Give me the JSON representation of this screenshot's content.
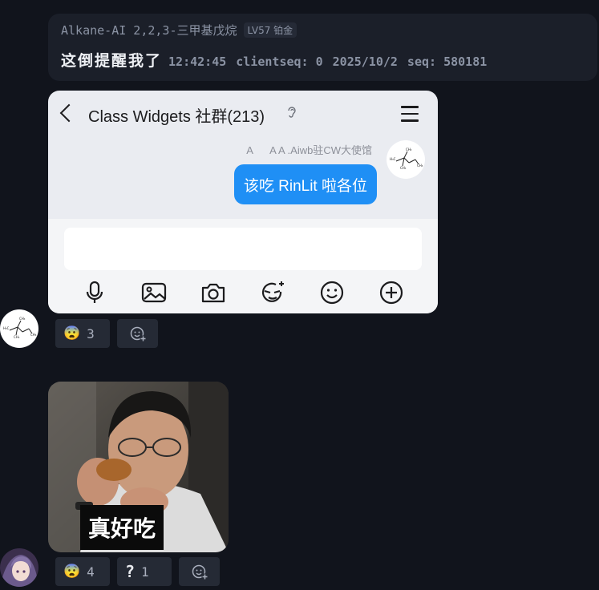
{
  "message1": {
    "sender_name": "Alkane-AI 2,2,3-三甲基戊烷",
    "level": "LV57 铂金",
    "text": "这倒提醒我了",
    "time": "12:42:45",
    "clientseq": "clientseq: 0",
    "date": "2025/10/2",
    "seq": "seq: 580181"
  },
  "screenshot": {
    "title": "Class Widgets 社群(213)",
    "msg_sender": "A      A A .Aiwb驻CW大使馆",
    "msg_text": "该吃 RinLit 啦各位",
    "tools": [
      "mic-icon",
      "image-icon",
      "camera-icon",
      "sticker-icon",
      "emoji-icon",
      "plus-icon"
    ]
  },
  "reactions1": [
    {
      "emoji": "😨",
      "count": "3"
    },
    {
      "emoji": "add-reaction-icon",
      "count": ""
    }
  ],
  "meme": {
    "caption": "真好吃"
  },
  "reactions2": [
    {
      "emoji": "😨",
      "count": "4"
    },
    {
      "emoji": "?",
      "count": "1"
    },
    {
      "emoji": "add-reaction-icon",
      "count": ""
    }
  ],
  "colors": {
    "background": "#11141c",
    "bubble": "#1b1f29",
    "accent_blue": "#1f8ff5"
  }
}
